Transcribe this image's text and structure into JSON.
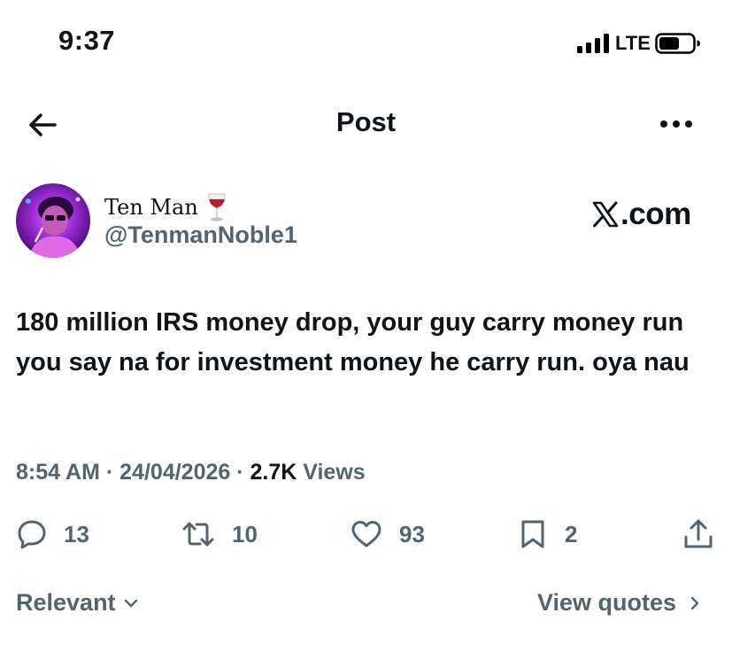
{
  "status_bar": {
    "time": "9:37",
    "network": "LTE",
    "icons": [
      "signal-icon",
      "battery-icon"
    ]
  },
  "header": {
    "title": "Post",
    "back_icon": "arrow-left-icon",
    "more_icon": "more-icon"
  },
  "author": {
    "display_name": "Ten Man",
    "emoji": "wine-glass-icon",
    "handle": "@TenmanNoble1",
    "brand_watermark": ".com"
  },
  "tweet": {
    "text": "180 million IRS money drop, your guy carry money run you say na for investment money he carry run. oya nau"
  },
  "meta": {
    "time": "8:54 AM",
    "sep1": " · ",
    "date": "24/04/2026",
    "sep2": " · ",
    "views_count": "2.7K",
    "views_label": " Views"
  },
  "actions": {
    "replies": "13",
    "reposts": "10",
    "likes": "93",
    "bookmarks": "2"
  },
  "footer": {
    "sort_label": "Relevant",
    "quotes_label": "View quotes"
  },
  "colors": {
    "text": "#0f1419",
    "secondary": "#536471",
    "background": "#ffffff"
  }
}
